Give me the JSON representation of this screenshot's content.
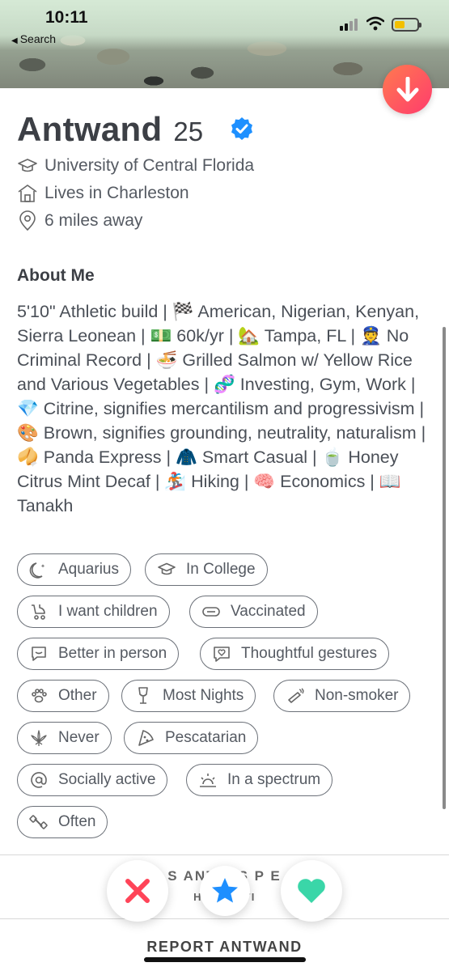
{
  "status_bar": {
    "time": "10:11",
    "back_label": "Search"
  },
  "profile": {
    "name": "Antwand",
    "age": "25",
    "verified_color": "#1e90ff",
    "school": "University of Central Florida",
    "residence": "Lives in Charleston",
    "distance": "6 miles away"
  },
  "about": {
    "title": "About Me",
    "text": "5'10\" Athletic build | 🏁 American, Nigerian, Kenyan, Sierra Leonean | 💵 60k/yr | 🏡 Tampa, FL | 👮 No Criminal Record | 🍜 Grilled Salmon w/ Yellow Rice and Various Vegetables | 🧬 Investing, Gym, Work | 💎 Citrine, signifies mercantilism and progressivism | 🎨 Brown, signifies grounding, neutrality, naturalism | 🥠 Panda Express | 🧥 Smart Casual | 🍵 Honey Citrus Mint Decaf | 🏂 Hiking | 🧠 Economics | 📖 Tanakh"
  },
  "chips": [
    {
      "label": "Aquarius",
      "icon": "moon-icon"
    },
    {
      "label": "In College",
      "icon": "graduation-cap-icon"
    },
    {
      "label": "I want children",
      "icon": "stroller-icon"
    },
    {
      "label": "Vaccinated",
      "icon": "pill-icon"
    },
    {
      "label": "Better in person",
      "icon": "chat-bubble-icon"
    },
    {
      "label": "Thoughtful gestures",
      "icon": "heart-message-icon"
    },
    {
      "label": "Other",
      "icon": "paw-icon"
    },
    {
      "label": "Most Nights",
      "icon": "wine-glass-icon"
    },
    {
      "label": "Non-smoker",
      "icon": "cigarette-icon"
    },
    {
      "label": "Never",
      "icon": "cannabis-leaf-icon"
    },
    {
      "label": "Pescatarian",
      "icon": "pizza-slice-icon"
    },
    {
      "label": "Socially active",
      "icon": "at-sign-icon"
    },
    {
      "label": "In a spectrum",
      "icon": "sunrise-icon"
    },
    {
      "label": "Often",
      "icon": "dumbbell-icon"
    }
  ],
  "share": {
    "line1_fragments": "S        ANT       D'S P        E",
    "line2_fragments": "HAT        ND TI"
  },
  "actions": {
    "nope_color": "#ff4458",
    "superlike_color": "#1e8fff",
    "like_color": "#3ad6a8"
  },
  "report_label": "REPORT ANTWAND"
}
